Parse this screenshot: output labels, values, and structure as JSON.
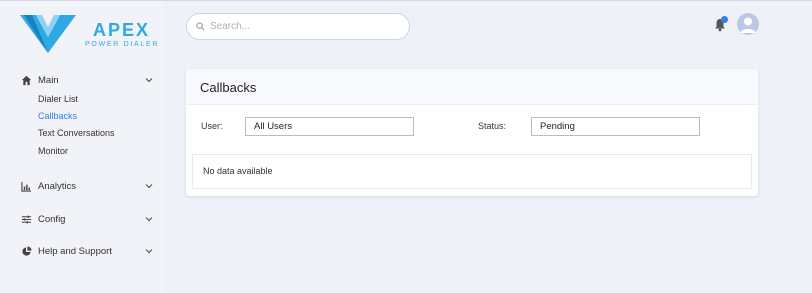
{
  "brand": {
    "name": "APEX",
    "tagline": "POWER DIALER",
    "color": "#2fa9e3"
  },
  "search": {
    "placeholder": "Search...",
    "value": ""
  },
  "header": {
    "notification_icon": "bell-icon",
    "notification_dot_color": "#2f80ed",
    "avatar_icon": "user-avatar-icon"
  },
  "sidebar": {
    "groups": [
      {
        "label": "Main",
        "icon": "home-icon",
        "expanded": true,
        "items": [
          {
            "label": "Dialer List",
            "active": false
          },
          {
            "label": "Callbacks",
            "active": true
          },
          {
            "label": "Text Conversations",
            "active": false
          },
          {
            "label": "Monitor",
            "active": false
          }
        ]
      },
      {
        "label": "Analytics",
        "icon": "bar-chart-icon",
        "expanded": false
      },
      {
        "label": "Config",
        "icon": "sliders-icon",
        "expanded": false
      },
      {
        "label": "Help and Support",
        "icon": "pie-chart-icon",
        "expanded": false
      }
    ],
    "active_color": "#2f80ed"
  },
  "card": {
    "title": "Callbacks",
    "filters": {
      "user": {
        "label": "User:",
        "value": "All Users"
      },
      "status": {
        "label": "Status:",
        "value": "Pending"
      }
    },
    "empty_message": "No data available"
  }
}
